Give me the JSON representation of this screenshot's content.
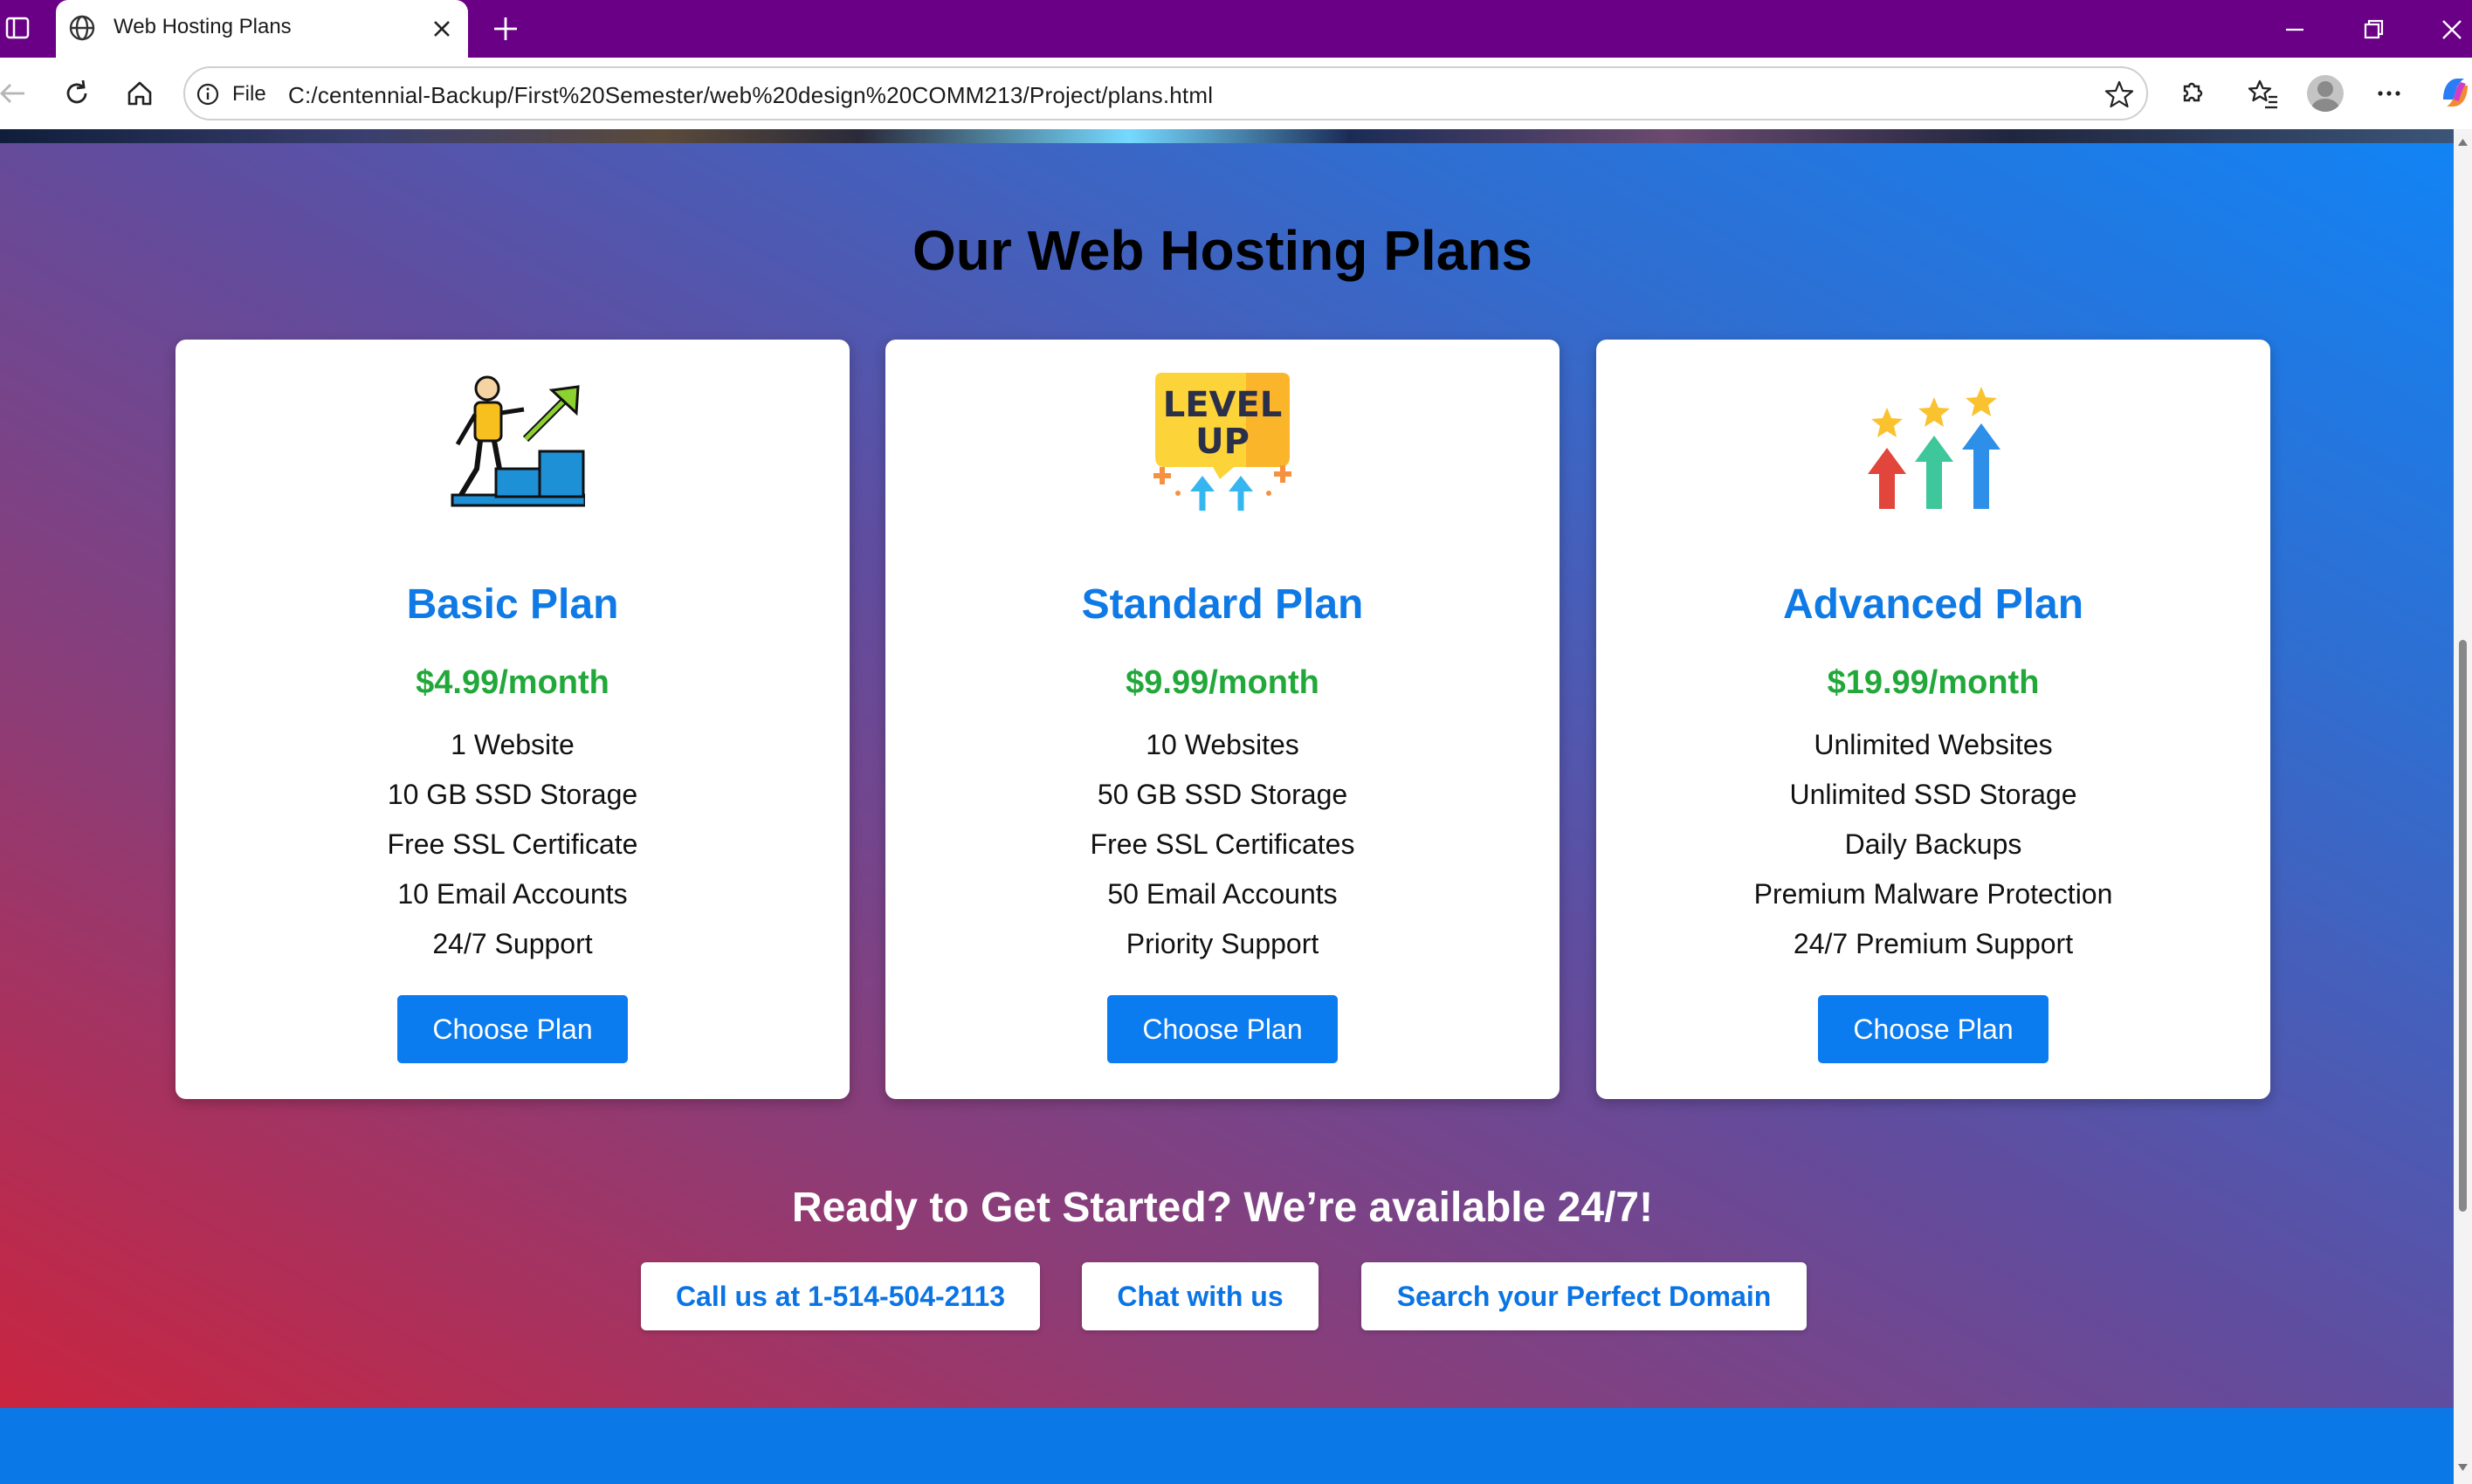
{
  "browser": {
    "tab_title": "Web Hosting Plans",
    "address": {
      "scheme_label": "File",
      "url": "C:/centennial-Backup/First%20Semester/web%20design%20COMM213/Project/plans.html"
    },
    "theme_color": "#6a0085"
  },
  "page": {
    "title": "Our Web Hosting Plans",
    "plans": [
      {
        "name": "Basic Plan",
        "price": "$4.99/month",
        "icon": "growth-stairs-icon",
        "features": [
          "1 Website",
          "10 GB SSD Storage",
          "Free SSL Certificate",
          "10 Email Accounts",
          "24/7 Support"
        ],
        "button_label": "Choose Plan"
      },
      {
        "name": "Standard Plan",
        "price": "$9.99/month",
        "icon": "level-up-icon",
        "icon_text_line1": "LEVEL",
        "icon_text_line2": "UP",
        "features": [
          "10 Websites",
          "50 GB SSD Storage",
          "Free SSL Certificates",
          "50 Email Accounts",
          "Priority Support"
        ],
        "button_label": "Choose Plan"
      },
      {
        "name": "Advanced Plan",
        "price": "$19.99/month",
        "icon": "star-arrows-icon",
        "features": [
          "Unlimited Websites",
          "Unlimited SSD Storage",
          "Daily Backups",
          "Premium Malware Protection",
          "24/7 Premium Support"
        ],
        "button_label": "Choose Plan"
      }
    ],
    "cta": {
      "heading": "Ready to Get Started? We’re available 24/7!",
      "buttons": [
        "Call us at 1-514-504-2113",
        "Chat with us",
        "Search your Perfect Domain"
      ]
    },
    "colors": {
      "plan_name": "#0f7ae5",
      "price": "#22a83a",
      "primary_button": "#0b7bf0",
      "footer": "#0b78e8"
    }
  }
}
